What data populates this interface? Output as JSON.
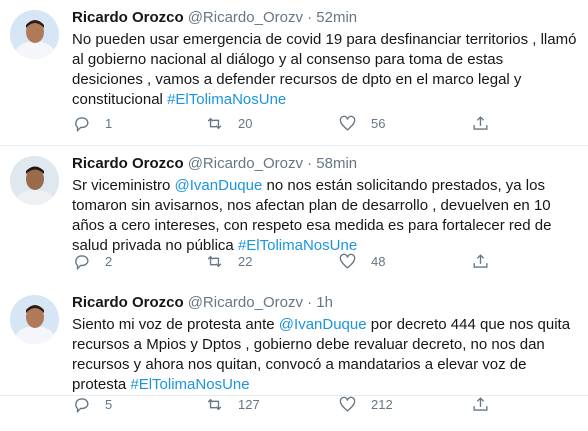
{
  "tweets": [
    {
      "name": "Ricardo Orozco",
      "handle": "@Ricardo_Orozv",
      "dot": "·",
      "time": "52min",
      "text_parts": [
        "No pueden usar emergencia de covid 19 para desfinanciar territorios , llamó al gobierno nacional al diálogo y al consenso para toma de estas desiciones , vamos a defender recursos de dpto en el marco legal y constitucional "
      ],
      "mentions": [],
      "hashtag": "#ElTolimaNosUne",
      "replies": "1",
      "retweets": "20",
      "likes": "56"
    },
    {
      "name": "Ricardo Orozco",
      "handle": "@Ricardo_Orozv",
      "dot": "·",
      "time": "58min",
      "text_before": "Sr viceministro ",
      "mention": "@IvanDuque",
      "text_after": " no nos están solicitando prestados, ya los tomaron sin avisarnos, nos afectan plan de desarrollo , devuelven en 10 años a cero intereses, con respeto esa medida es para fortalecer red de salud privada no pública ",
      "hashtag": "#ElTolimaNosUne",
      "replies": "2",
      "retweets": "22",
      "likes": "48"
    },
    {
      "name": "Ricardo Orozco",
      "handle": "@Ricardo_Orozv",
      "dot": "·",
      "time": "1h",
      "text_before": "Siento mi voz de protesta ante ",
      "mention": "@IvanDuque",
      "text_after": " por decreto 444 que nos quita recursos a Mpios y Dptos , gobierno debe revaluar decreto, no nos dan recursos y ahora nos quitan, convocó a mandatarios a elevar voz de protesta ",
      "hashtag": "#ElTolimaNosUne",
      "replies": "5",
      "retweets": "127",
      "likes": "212"
    }
  ],
  "icons": {
    "reply": "reply-icon",
    "retweet": "retweet-icon",
    "like": "heart-icon",
    "share": "share-icon"
  },
  "colors": {
    "link": "#1b95e0",
    "muted": "#657786",
    "text": "#14171a",
    "divider": "#e6ecf0"
  }
}
